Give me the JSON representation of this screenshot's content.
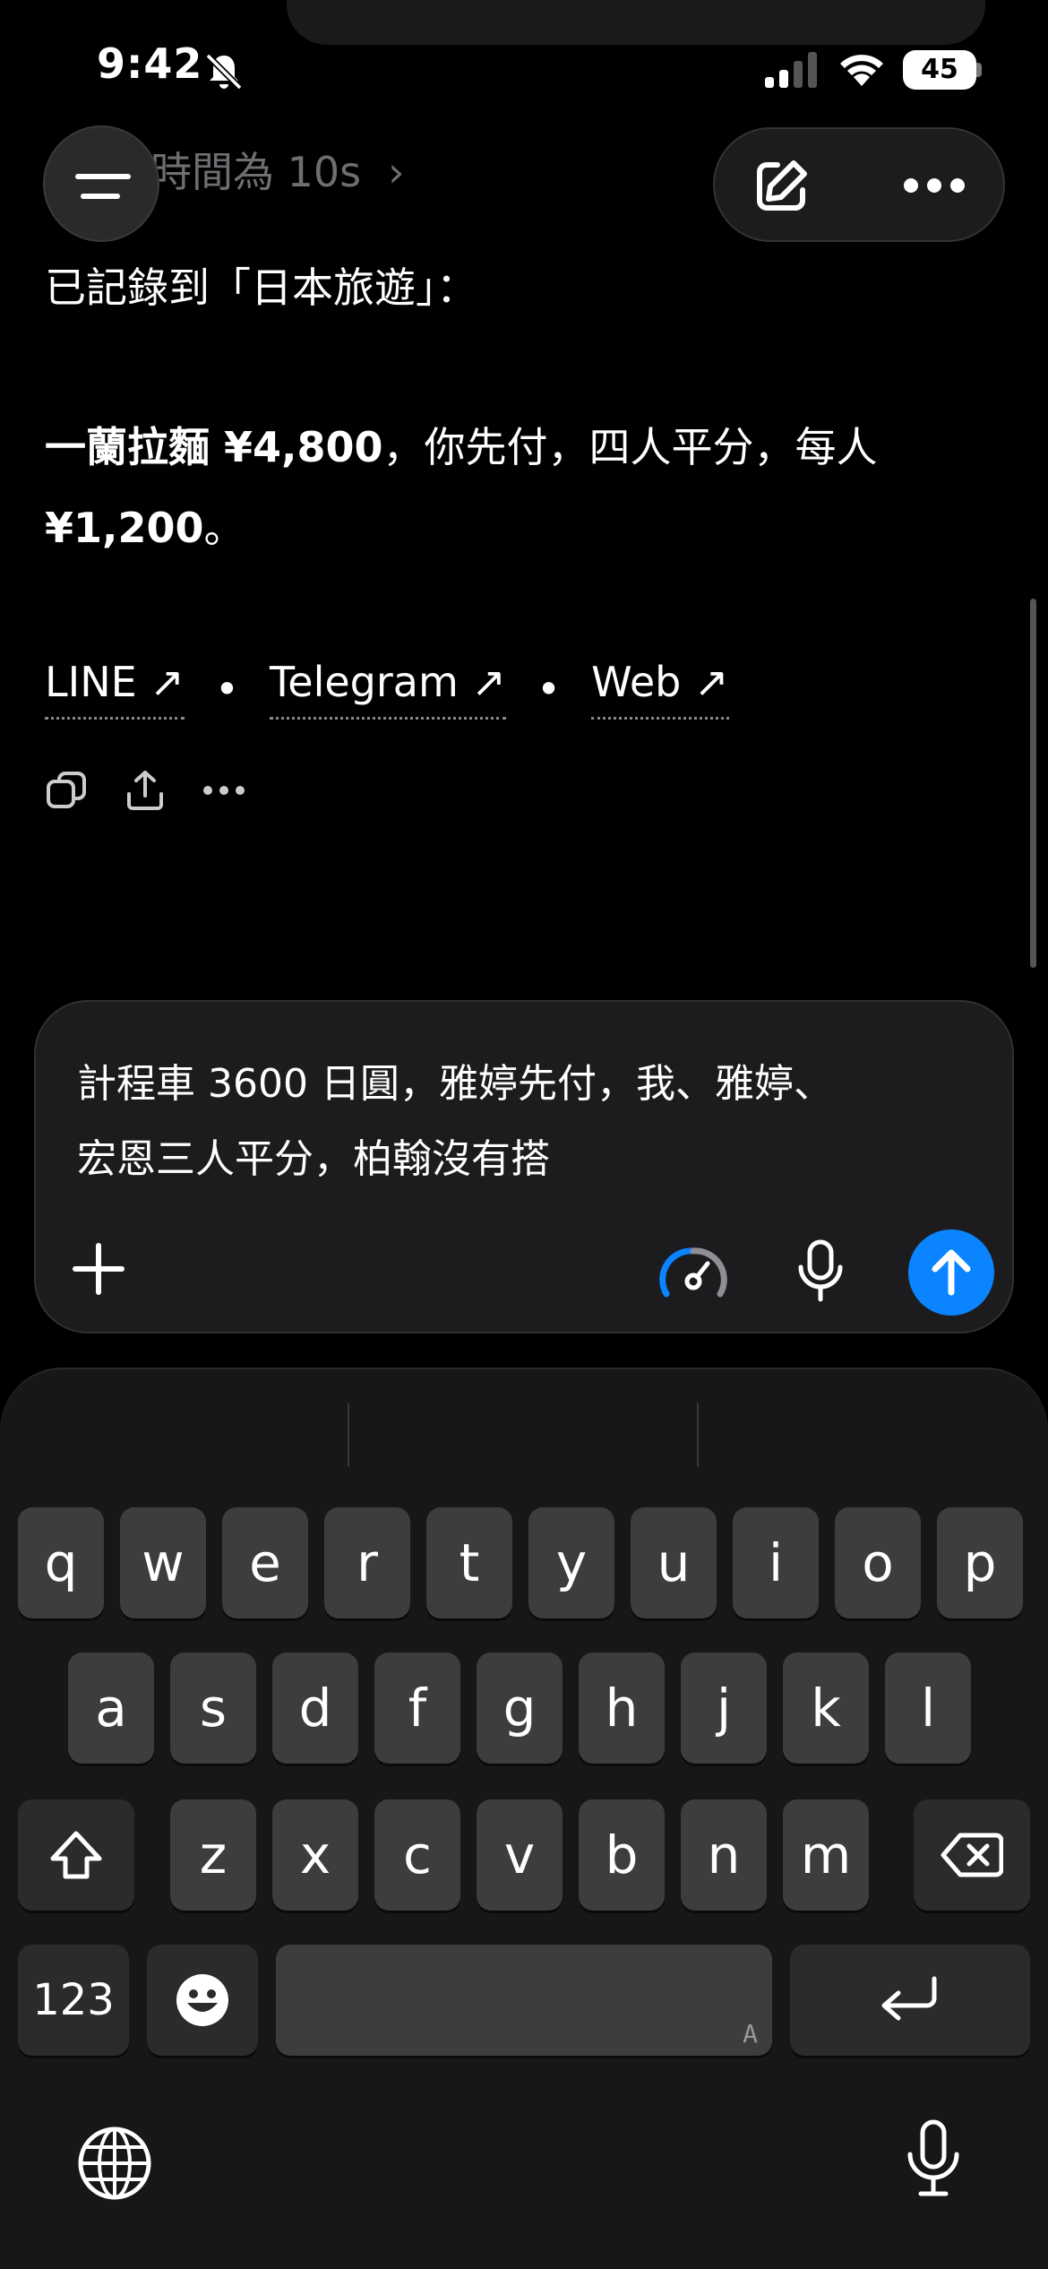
{
  "status_bar": {
    "time": "9:42",
    "battery": "45",
    "icons": [
      "bell-slash-icon",
      "signal-icon",
      "wifi-icon",
      "battery-icon"
    ]
  },
  "top_bar": {
    "previous_message_fragment": "時間為 10s",
    "menu_icon": "hamburger-icon",
    "new_chat_icon": "edit-icon",
    "more_icon": "ellipsis-icon"
  },
  "message": {
    "recorded_line": "已記錄到「日本旅遊」：",
    "expense_bold": "一蘭拉麵 ¥4,800",
    "expense_rest": "，你先付，四人平分，每人",
    "per_person_bold": "¥1,200",
    "per_person_rest": "。",
    "links": [
      {
        "label": "LINE ↗"
      },
      {
        "label": "Telegram ↗"
      },
      {
        "label": "Web ↗"
      }
    ],
    "separator": "•",
    "actions": [
      "copy-icon",
      "share-icon",
      "more-icon"
    ]
  },
  "composer": {
    "text_line1": "計程車 3600 日圓，雅婷先付，我、雅婷、",
    "text_line2": "宏恩三人平分，柏翰沒有搭",
    "accent": "#0a84ff"
  },
  "keyboard": {
    "row1": [
      "q",
      "w",
      "e",
      "r",
      "t",
      "y",
      "u",
      "i",
      "o",
      "p"
    ],
    "row2": [
      "a",
      "s",
      "d",
      "f",
      "g",
      "h",
      "j",
      "k",
      "l"
    ],
    "row3": [
      "z",
      "x",
      "c",
      "v",
      "b",
      "n",
      "m"
    ],
    "numbers_label": "123",
    "space_hint": "A"
  }
}
